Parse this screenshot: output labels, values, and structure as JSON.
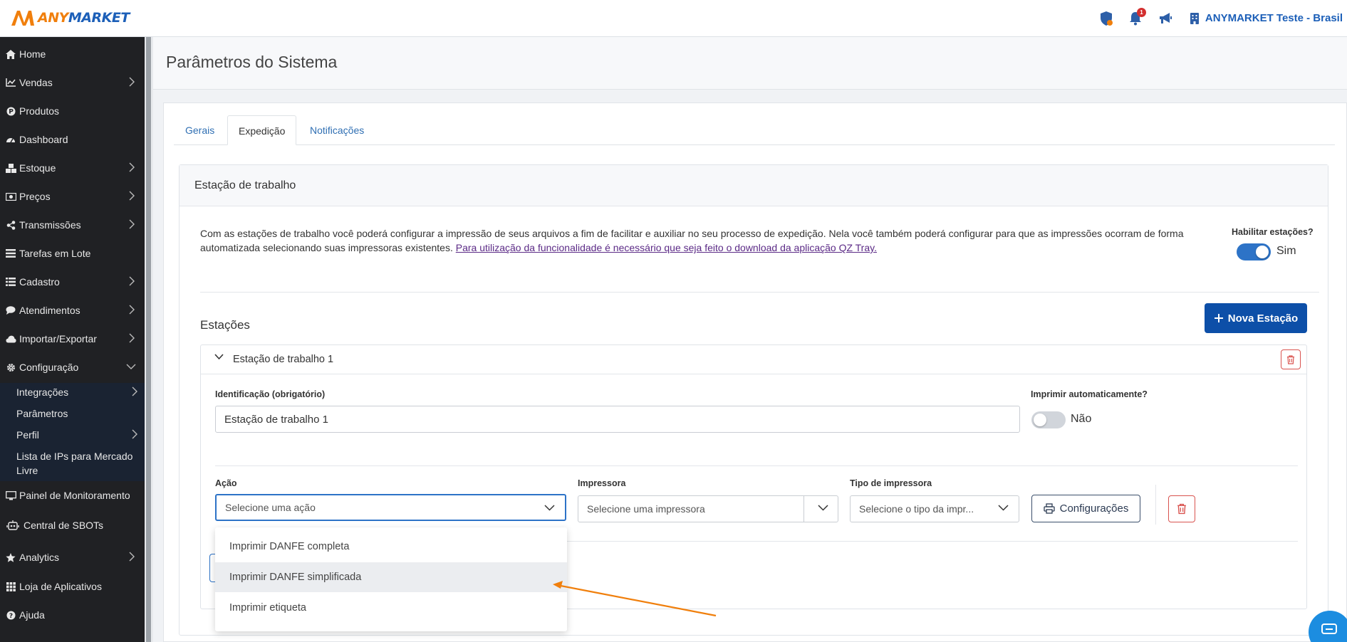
{
  "brand": {
    "logo_text_any": "ANY",
    "logo_text_market": "MARKET",
    "accent": "#f07f0c",
    "primary": "#1c5fb8"
  },
  "topbar": {
    "notification_count": "1",
    "user_name": "ANYMARKET Teste - Brasil"
  },
  "sidebar": {
    "items": [
      {
        "label": "Home",
        "icon": "home-icon"
      },
      {
        "label": "Vendas",
        "icon": "chart-line-icon"
      },
      {
        "label": "Produtos",
        "icon": "product-icon"
      },
      {
        "label": "Dashboard",
        "icon": "dashboard-icon"
      },
      {
        "label": "Estoque",
        "icon": "boxes-icon"
      },
      {
        "label": "Preços",
        "icon": "money-icon"
      },
      {
        "label": "Transmissões",
        "icon": "share-icon"
      },
      {
        "label": "Tarefas em Lote",
        "icon": "batch-icon"
      },
      {
        "label": "Cadastro",
        "icon": "list-icon"
      },
      {
        "label": "Atendimentos",
        "icon": "chat-icon"
      },
      {
        "label": "Importar/Exportar",
        "icon": "cloud-icon"
      },
      {
        "label": "Configuração",
        "icon": "gear-icon"
      }
    ],
    "sub_items": [
      {
        "label": "Integrações"
      },
      {
        "label": "Parâmetros"
      },
      {
        "label": "Perfil"
      },
      {
        "label": "Lista de IPs para Mercado Livre"
      }
    ],
    "bottom_items": [
      {
        "label": "Painel de Monitoramento",
        "icon": "monitor-icon"
      },
      {
        "label": "Central de SBOTs",
        "icon": "robot-icon"
      },
      {
        "label": "Analytics",
        "icon": "star-icon"
      },
      {
        "label": "Loja de Aplicativos",
        "icon": "grid-icon"
      },
      {
        "label": "Ajuda",
        "icon": "help-icon"
      }
    ]
  },
  "page": {
    "title": "Parâmetros do Sistema"
  },
  "tabs": [
    {
      "label": "Gerais"
    },
    {
      "label": "Expedição",
      "active": true
    },
    {
      "label": "Notificações"
    }
  ],
  "panel": {
    "title": "Estação de trabalho",
    "description": "Com as estações de trabalho você poderá configurar a impressão de seus arquivos a fim de facilitar e auxiliar no seu processo de expedição. Nela você também poderá configurar para que as impressões ocorram de forma automatizada selecionando suas impressoras existentes.",
    "link_text": "Para utilização da funcionalidade é necessário que seja feito o download da aplicação QZ Tray.",
    "enable_label": "Habilitar estações?",
    "enable_value": "Sim",
    "stations_heading": "Estações",
    "new_station_label": "Nova Estação"
  },
  "station": {
    "title": "Estação de trabalho 1",
    "id_label": "Identificação (obrigatório)",
    "id_value": "Estação de trabalho 1",
    "auto_print_label": "Imprimir automaticamente?",
    "auto_print_value": "Não",
    "action_label": "Ação",
    "action_placeholder": "Selecione uma ação",
    "printer_label": "Impressora",
    "printer_placeholder": "Selecione uma impressora",
    "printer_type_label": "Tipo de impressora",
    "printer_type_placeholder": "Selecione o tipo da impr...",
    "config_label": "Configurações"
  },
  "action_options": [
    {
      "label": "Imprimir DANFE completa"
    },
    {
      "label": "Imprimir DANFE simplificada",
      "highlighted": true
    },
    {
      "label": "Imprimir etiqueta"
    }
  ]
}
